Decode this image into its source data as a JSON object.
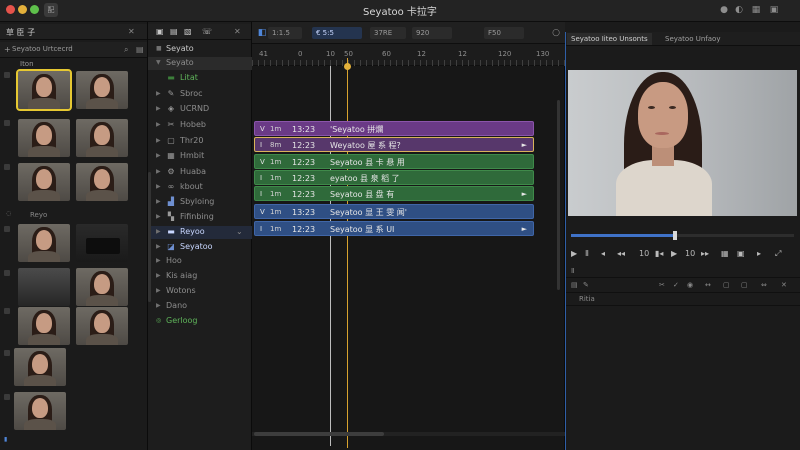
{
  "titlebar": {
    "title": "Seyatoo 卡拉字",
    "tab_label": "配",
    "left_label": "ⅡⅡ Ⅰ"
  },
  "browser": {
    "header_title": "草 臣 子",
    "library_name": "Seyatoo Urtcecrd",
    "sub_label": "Iton",
    "groups": [
      {
        "label": "Reyo"
      }
    ]
  },
  "library": {
    "header": "Seyato",
    "items": [
      {
        "label": "Seyato",
        "type": "folder"
      },
      {
        "label": "Litat",
        "type": "green"
      },
      {
        "label": "Sbroc"
      },
      {
        "label": "UCRND"
      },
      {
        "label": "Hobeb"
      },
      {
        "label": "Thr20"
      },
      {
        "label": "Hmbit"
      },
      {
        "label": "Huaba"
      },
      {
        "label": "kbout"
      },
      {
        "label": "Sbyloing"
      },
      {
        "label": "Fifinbing"
      },
      {
        "label": "Reyoo"
      },
      {
        "label": "Seyatoo"
      },
      {
        "label": "Hoo"
      },
      {
        "label": "Kis aiag"
      },
      {
        "label": "Wotons"
      },
      {
        "label": "Dano"
      },
      {
        "label": "Gerloog"
      }
    ]
  },
  "timeline": {
    "toolbar": {
      "field_1": "1:1.5",
      "field_2": "€ 5:5",
      "field_3": "37RE",
      "field_4": "920",
      "field_5": "F50"
    },
    "ruler_labels": [
      "41",
      "0",
      "10",
      "50",
      "60",
      "12",
      "12",
      "120",
      "130"
    ],
    "playhead_value": "50",
    "clips": [
      {
        "flag": "V",
        "mark": "1m",
        "time": "13:23",
        "title": "'Seyatoo 拼爛",
        "end": "",
        "color": "purple"
      },
      {
        "flag": "I",
        "mark": "8m",
        "time": "12:23",
        "title": "Weyatoo 屋 系 程?",
        "end": "►",
        "color": "purple2"
      },
      {
        "flag": "V",
        "mark": "1m",
        "time": "12:23",
        "title": "Seyatoo 县 卡 悬 用",
        "end": "",
        "color": "green"
      },
      {
        "flag": "I",
        "mark": "1m",
        "time": "12:23",
        "title": "eyatoo 县 泉 稻 了",
        "end": "",
        "color": "green"
      },
      {
        "flag": "I",
        "mark": "1m",
        "time": "12:23",
        "title": "Seyatoo 县 盘 有",
        "end": "►",
        "color": "green"
      },
      {
        "flag": "V",
        "mark": "1m",
        "time": "13:23",
        "title": "Seyatoo 显 王 雯 闻'",
        "end": "",
        "color": "blue"
      },
      {
        "flag": "I",
        "mark": "1m",
        "time": "12:23",
        "title": "Seyatoo 显 系 UI",
        "end": "►",
        "color": "blue"
      }
    ]
  },
  "viewer": {
    "tab_active": "Seyatoo Iiteo Unsonts",
    "tab_2": "Seyatoo Unfaoy",
    "transport_time_1": "10",
    "transport_time_2": "10",
    "sub_1_label": "Ⅱ",
    "sub_2_label": "Ritia"
  },
  "colors": {
    "playhead": "#e3b13b",
    "accent_blue": "#3f72c8",
    "clip_purple": "#6a3a86",
    "clip_green": "#2f6a3a",
    "clip_blue": "#2f4f84"
  }
}
